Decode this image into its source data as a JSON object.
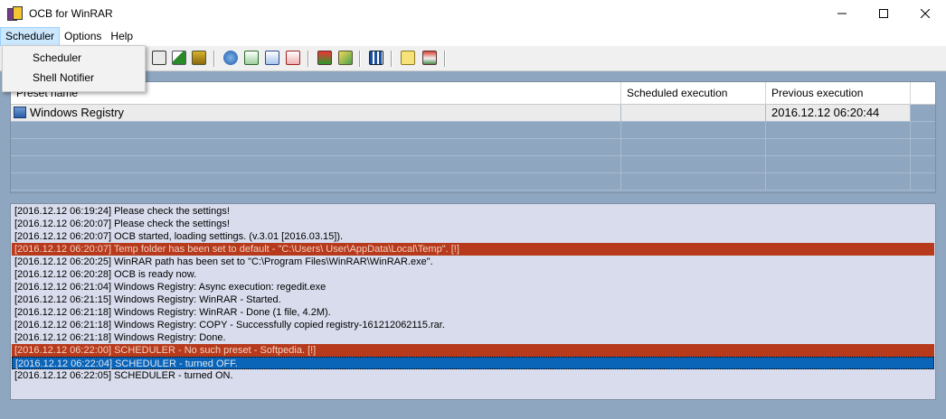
{
  "window": {
    "title": "OCB for WinRAR"
  },
  "menubar": {
    "items": [
      {
        "label": "Scheduler"
      },
      {
        "label": "Options"
      },
      {
        "label": "Help"
      }
    ]
  },
  "dropdown": {
    "items": [
      {
        "label": "Scheduler"
      },
      {
        "label": "Shell Notifier"
      }
    ]
  },
  "grid": {
    "columns": [
      "Preset name",
      "Scheduled execution",
      "Previous execution"
    ],
    "rows": [
      {
        "name": "Windows Registry",
        "scheduled": "",
        "previous": "2016.12.12 06:20:44"
      }
    ]
  },
  "log": {
    "lines": [
      {
        "text": "[2016.12.12 06:19:24] Please check the settings!",
        "type": "normal"
      },
      {
        "text": "[2016.12.12 06:20:07] Please check the settings!",
        "type": "normal"
      },
      {
        "text": "[2016.12.12 06:20:07] OCB started, loading settings. (v.3.01 [2016.03.15]).",
        "type": "normal"
      },
      {
        "text": "[2016.12.12 06:20:07] Temp folder has been set to default - \"C:\\Users\\   User\\AppData\\Local\\Temp\". [!]",
        "type": "error"
      },
      {
        "text": "[2016.12.12 06:20:25] WinRAR path has been set to \"C:\\Program Files\\WinRAR\\WinRAR.exe\".",
        "type": "normal"
      },
      {
        "text": "[2016.12.12 06:20:28] OCB is ready now.",
        "type": "normal"
      },
      {
        "text": "[2016.12.12 06:21:04] Windows Registry: Async execution:  regedit.exe",
        "type": "normal"
      },
      {
        "text": "[2016.12.12 06:21:15] Windows Registry: WinRAR - Started.",
        "type": "normal"
      },
      {
        "text": "[2016.12.12 06:21:18] Windows Registry: WinRAR - Done (1 file, 4.2M).",
        "type": "normal"
      },
      {
        "text": "[2016.12.12 06:21:18] Windows Registry: COPY - Successfully copied registry-161212062115.rar.",
        "type": "normal"
      },
      {
        "text": "[2016.12.12 06:21:18] Windows Registry: Done.",
        "type": "normal"
      },
      {
        "text": "[2016.12.12 06:22:00] SCHEDULER - No such preset - Softpedia. [!]",
        "type": "error"
      },
      {
        "text": "[2016.12.12 06:22:04] SCHEDULER - turned OFF.",
        "type": "selected"
      },
      {
        "text": "[2016.12.12 06:22:05] SCHEDULER - turned ON.",
        "type": "normal"
      }
    ]
  },
  "toolbar": {
    "icons": [
      "preset-list-icon",
      "chart-icon",
      "transfer-icon",
      "open-folder-icon",
      "import-icon",
      "export-icon",
      "delete-icon",
      "home-up-icon",
      "edit-icon",
      "columns-icon",
      "help-icon",
      "home-icon"
    ]
  },
  "colors": {
    "background": "#8fa6c0",
    "log_background": "#d8dcec",
    "log_error": "#b73a1c",
    "log_selected": "#0a64b8"
  }
}
